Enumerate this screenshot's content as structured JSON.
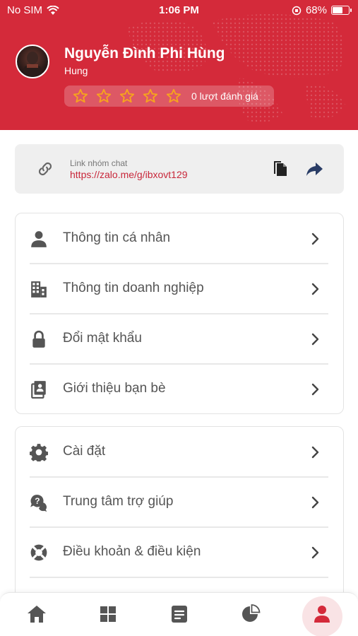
{
  "status_bar": {
    "carrier": "No SIM",
    "time": "1:06 PM",
    "battery": "68%",
    "battery_level": 0.68
  },
  "profile": {
    "name": "Nguyễn Đình Phi Hùng",
    "username": "Hung",
    "rating_stars": 0,
    "rating_max": 5,
    "rating_text": "0 lượt đánh giá"
  },
  "group_link": {
    "label": "Link nhóm chat",
    "url": "https://zalo.me/g/ibxovt129"
  },
  "menu_1": [
    {
      "label": "Thông tin cá nhân",
      "icon": "person-icon"
    },
    {
      "label": "Thông tin doanh nghiệp",
      "icon": "building-icon"
    },
    {
      "label": "Đổi mật khẩu",
      "icon": "lock-icon"
    },
    {
      "label": "Giới thiệu bạn bè",
      "icon": "referral-document-icon"
    }
  ],
  "menu_2": [
    {
      "label": "Cài đặt",
      "icon": "gear-icon"
    },
    {
      "label": "Trung tâm trợ giúp",
      "icon": "help-chat-icon"
    },
    {
      "label": "Điều khoản & điều kiện",
      "icon": "lifebuoy-icon"
    }
  ],
  "bottom_nav": [
    {
      "icon": "home-icon"
    },
    {
      "icon": "grid-icon"
    },
    {
      "icon": "orders-icon"
    },
    {
      "icon": "pie-chart-icon"
    },
    {
      "icon": "profile-icon",
      "active": true
    }
  ],
  "colors": {
    "brand": "#d42a3a",
    "star": "#f7a51c",
    "link": "#c8273a",
    "text": "#555555"
  }
}
